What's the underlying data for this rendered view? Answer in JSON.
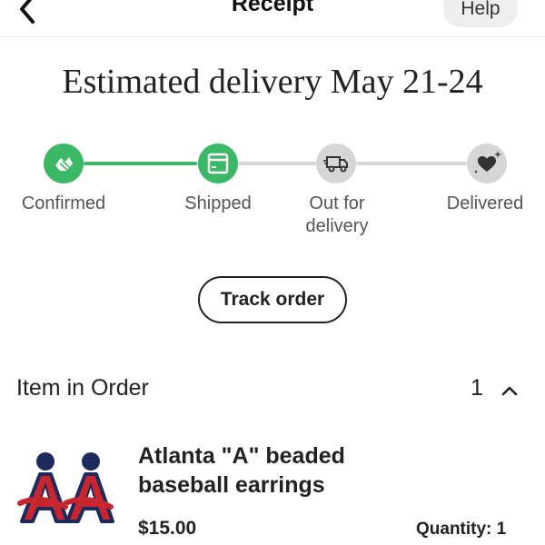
{
  "header": {
    "title": "Receipt",
    "help_label": "Help",
    "back_icon": "chevron-left-icon"
  },
  "delivery": {
    "estimate": "Estimated delivery May 21-24"
  },
  "progress": {
    "completed_color": "#3bb866",
    "pending_color": "#d6d6d6",
    "steps": [
      {
        "label": "Confirmed",
        "icon": "handshake-icon",
        "status": "complete"
      },
      {
        "label": "Shipped",
        "icon": "box-icon",
        "status": "complete"
      },
      {
        "label": "Out for delivery",
        "icon": "delivery-truck-icon",
        "status": "pending"
      },
      {
        "label": "Delivered",
        "icon": "heart-icon",
        "status": "pending"
      }
    ]
  },
  "actions": {
    "track_order_label": "Track order"
  },
  "order": {
    "section_title": "Item in Order",
    "count": "1",
    "collapse_icon": "chevron-up-icon",
    "items": [
      {
        "name": "Atlanta \"A\" beaded baseball earrings",
        "price": "$15.00",
        "quantity": "Quantity: 1",
        "thumbnail_icon": "earrings-thumbnail"
      }
    ]
  }
}
